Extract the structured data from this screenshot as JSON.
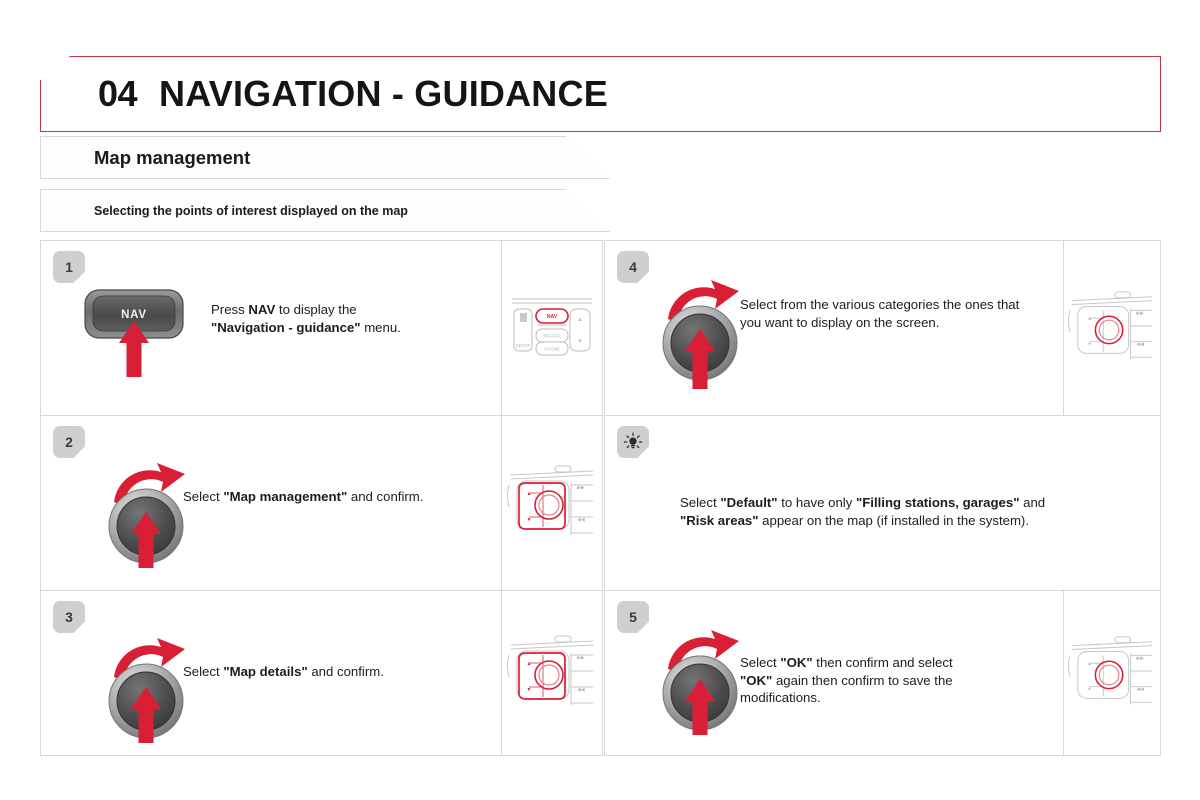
{
  "header": {
    "chapter_number": "04",
    "chapter_title": "NAVIGATION - GUIDANCE",
    "accent_color": "#c9324d"
  },
  "section": {
    "title": "Map management",
    "subtitle": "Selecting the points of interest displayed on the map"
  },
  "steps": {
    "step1": {
      "badge": "1",
      "text_html": "Press <b>NAV</b> to display the <br><b>\"Navigation - guidance\"</b> menu.",
      "control_label": "NAV",
      "control_type": "push-button",
      "panel_keys": [
        "NAV",
        "TRAFFIC",
        "PHONE",
        "SETUP"
      ]
    },
    "step2": {
      "badge": "2",
      "text_html": "Select <b>\"Map management\"</b> and confirm.",
      "control_type": "rotary-knob"
    },
    "step3": {
      "badge": "3",
      "text_html": "Select <b>\"Map details\"</b> and confirm.",
      "control_type": "rotary-knob"
    },
    "step4": {
      "badge": "4",
      "text_html": "Select from the various categories the ones that you want to display on the screen.",
      "control_type": "rotary-knob"
    },
    "tip": {
      "badge_icon": "light-bulb-icon",
      "text_html": "Select <b>\"Default\"</b> to have only <b>\"Filling stations, garages\"</b> and <br><b>\"Risk areas\"</b> appear on the map (if installed in the system)."
    },
    "step5": {
      "badge": "5",
      "text_html": "Select <b>\"OK\"</b> then confirm and select <br><b>\"OK\"</b> again then confirm to save the modifications.",
      "control_type": "rotary-knob"
    }
  },
  "colors": {
    "red_accent": "#d81f35",
    "header_red": "#c9324d",
    "badge_grey": "#cfcfcf",
    "border_grey": "#d9d9d9",
    "knob_dark": "#4f4f4f"
  }
}
